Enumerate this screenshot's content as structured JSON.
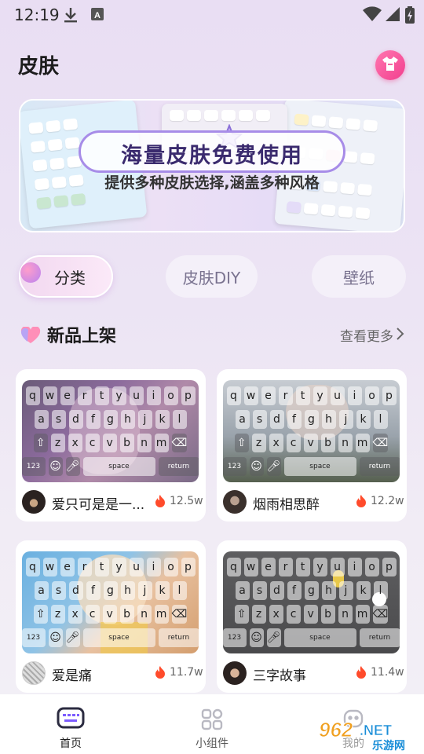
{
  "status_bar": {
    "time": "12:19"
  },
  "header": {
    "title": "皮肤",
    "skin_icon": "tshirt-icon"
  },
  "banner": {
    "title": "海量皮肤免费使用",
    "subtitle": "提供多种皮肤选择,涵盖多种风格"
  },
  "tabs": [
    {
      "label": "分类",
      "active": true
    },
    {
      "label": "皮肤DIY",
      "active": false
    },
    {
      "label": "壁纸",
      "active": false
    }
  ],
  "section": {
    "title": "新品上架",
    "more_label": "查看更多"
  },
  "keyboard_keys": {
    "row1": [
      "q",
      "w",
      "e",
      "r",
      "t",
      "y",
      "u",
      "i",
      "o",
      "p"
    ],
    "row2": [
      "a",
      "s",
      "d",
      "f",
      "g",
      "h",
      "j",
      "k",
      "l"
    ],
    "row3": [
      "z",
      "x",
      "c",
      "v",
      "b",
      "n",
      "m"
    ],
    "space": "space",
    "return": "return",
    "num": "123"
  },
  "cards": [
    {
      "name": "爱只可是是一...",
      "count": "12.5w"
    },
    {
      "name": "烟雨相思醉",
      "count": "12.2w"
    },
    {
      "name": "爱是痛",
      "count": "11.7w"
    },
    {
      "name": "三字故事",
      "count": "11.4w"
    }
  ],
  "bottom_nav": [
    {
      "label": "首页",
      "active": true
    },
    {
      "label": "小组件",
      "active": false
    },
    {
      "label": "我的",
      "active": false
    }
  ],
  "watermark": {
    "text": "962.NET",
    "sub": "乐游网"
  },
  "colors": {
    "accent_pink": "#f23f8e",
    "nav_active": "#1c1c1c",
    "fire": "#ff4b2b"
  }
}
